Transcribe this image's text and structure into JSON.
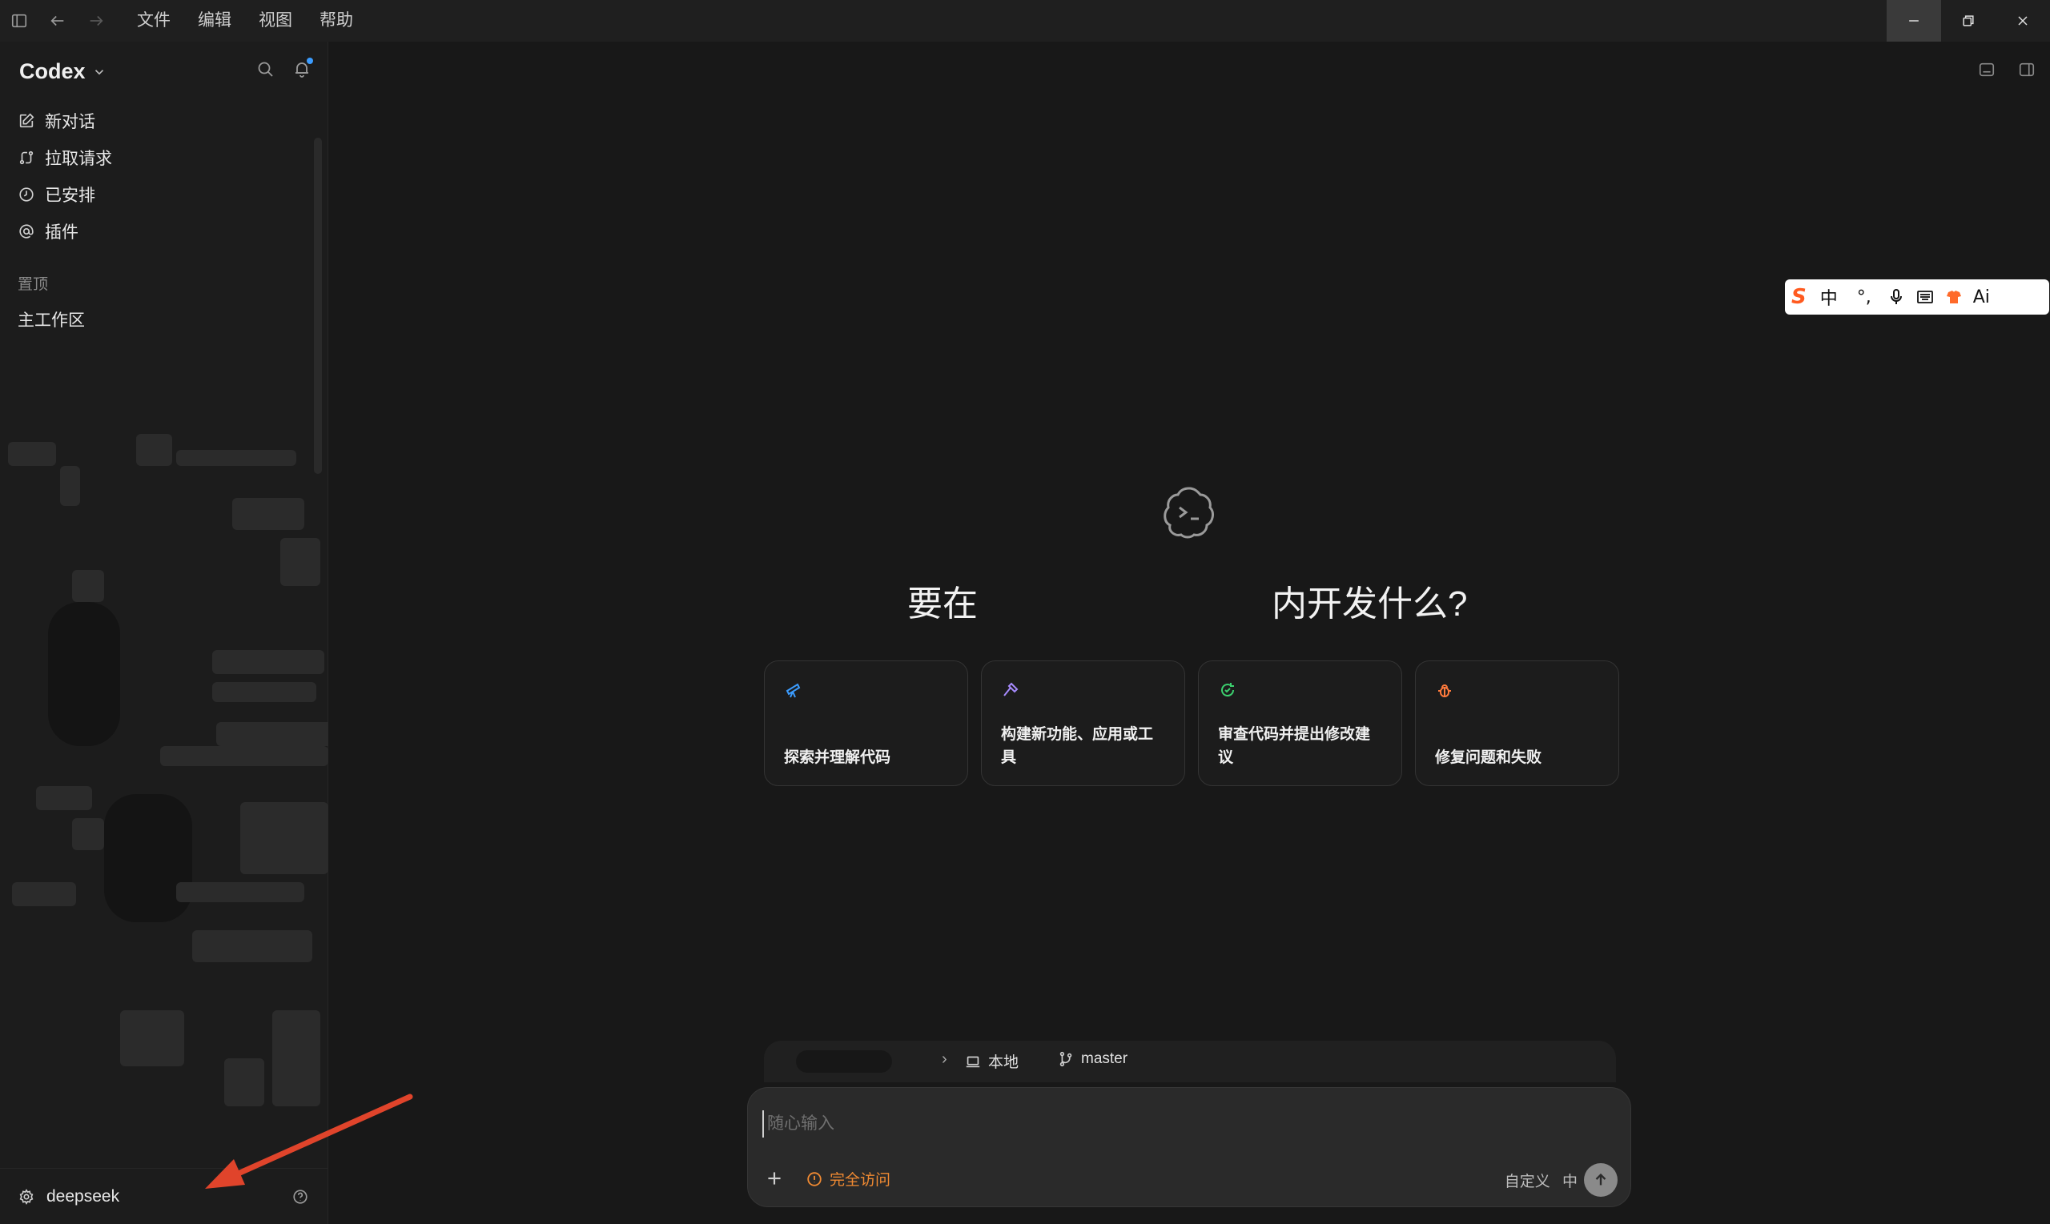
{
  "titlebar": {
    "menus": [
      "文件",
      "编辑",
      "视图",
      "帮助"
    ]
  },
  "sidebar": {
    "app_title": "Codex",
    "nav": [
      {
        "label": "新对话",
        "icon": "edit-icon"
      },
      {
        "label": "拉取请求",
        "icon": "pull-request-icon"
      },
      {
        "label": "已安排",
        "icon": "clock-icon"
      },
      {
        "label": "插件",
        "icon": "at-icon"
      }
    ],
    "section_label": "置顶",
    "pinned_item": "主工作区",
    "footer_user": "deepseek"
  },
  "main": {
    "headline_left": "要在",
    "headline_right": "内开发什么?",
    "cards": [
      {
        "label": "探索并理解代码",
        "icon": "telescope-icon",
        "color": "#3b9cff"
      },
      {
        "label": "构建新功能、应用或工具",
        "icon": "hammer-icon",
        "color": "#a88bff"
      },
      {
        "label": "审查代码并提出修改建议",
        "icon": "review-icon",
        "color": "#3ccf6e"
      },
      {
        "label": "修复问题和失败",
        "icon": "bug-icon",
        "color": "#ff7a3c"
      }
    ],
    "context": {
      "chevron": "›",
      "location": "本地",
      "branch": "master"
    },
    "composer": {
      "placeholder": "随心输入",
      "value": "",
      "access_label": "完全访问",
      "custom_label": "自定义",
      "lang_label": "中"
    }
  },
  "ime_toolbar": {
    "logo": "S",
    "mode": "中",
    "punct": "°,",
    "ai_label": "Ai"
  },
  "colors": {
    "background": "#181818",
    "sidebar": "#1c1c1c",
    "accent_orange": "#f08a32",
    "annotation_arrow": "#e0442b"
  }
}
